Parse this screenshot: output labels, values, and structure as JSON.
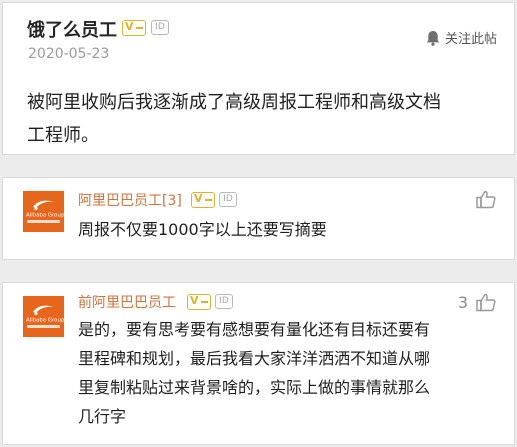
{
  "post": {
    "username": "饿了么员工",
    "badge_v": "V",
    "badge_id": "ID",
    "date": "2020-05-23",
    "follow_label": "关注此帖",
    "body_lines": [
      "被阿里收购后我逐渐成了高级周报工程师和高级文档",
      "工程师。"
    ]
  },
  "comments": [
    {
      "username": "阿里巴巴员工[3]",
      "badge_v": "V",
      "badge_id": "ID",
      "avatar_text": "Alibaba Group",
      "like_count": "",
      "body_lines": [
        "周报不仅要1000字以上还要写摘要"
      ]
    },
    {
      "username": "前阿里巴巴员工",
      "badge_v": "V",
      "badge_id": "ID",
      "avatar_text": "Alibaba Group",
      "like_count": "3",
      "body_lines": [
        "是的，要有思考要有感想要有量化还有目标还要有",
        "里程碑和规划，最后我看大家洋洋洒洒不知道从哪",
        "里复制粘贴过来背景啥的，实际上做的事情就那么",
        "几行字"
      ]
    }
  ],
  "colors": {
    "username_comment": "#d0733c",
    "avatar_bg": "#e8661b",
    "badge_gold": "#e2b12a"
  },
  "icons": [
    "bell-icon",
    "thumbs-up-icon",
    "alibaba-logo-icon"
  ]
}
